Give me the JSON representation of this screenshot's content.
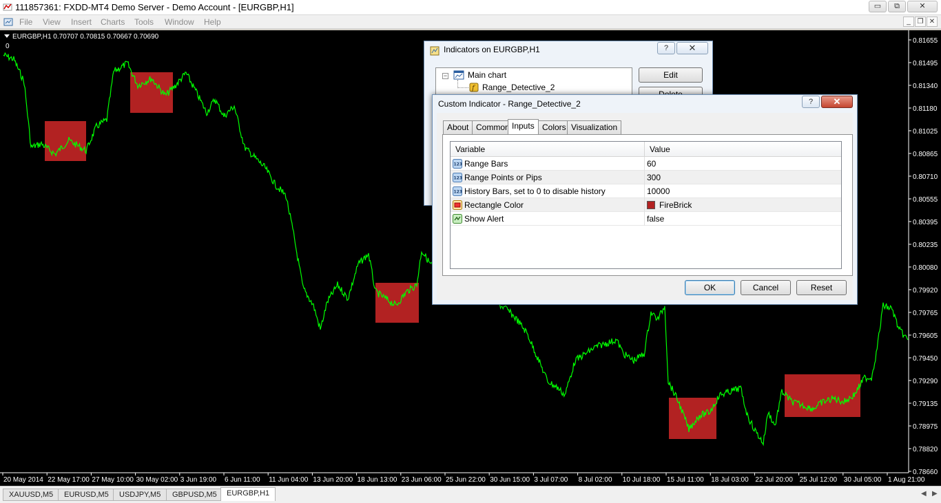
{
  "window": {
    "title": "111857361: FXDD-MT4 Demo Server - Demo Account - [EURGBP,H1]",
    "minimize_glyph": "▭",
    "restore_glyph": "⧉",
    "close_glyph": "✕",
    "mdi_minimize_glyph": "_",
    "mdi_restore_glyph": "❐",
    "mdi_close_glyph": "✕"
  },
  "menu": [
    "File",
    "View",
    "Insert",
    "Charts",
    "Tools",
    "Window",
    "Help"
  ],
  "chart": {
    "symbol_info": "EURGBP,H1  0.70707 0.70815 0.70667 0.70690",
    "zero_label": "0",
    "price_labels": [
      "0.81655",
      "0.81495",
      "0.81340",
      "0.81180",
      "0.81025",
      "0.80865",
      "0.80710",
      "0.80555",
      "0.80395",
      "0.80235",
      "0.80080",
      "0.79920",
      "0.79765",
      "0.79605",
      "0.79450",
      "0.79290",
      "0.79135",
      "0.78975",
      "0.78820",
      "0.78660"
    ],
    "time_labels": [
      "20 May 2014",
      "22 May 17:00",
      "27 May 10:00",
      "30 May 02:00",
      "3 Jun 19:00",
      "6 Jun 11:00",
      "11 Jun 04:00",
      "13 Jun 20:00",
      "18 Jun 13:00",
      "23 Jun 06:00",
      "25 Jun 22:00",
      "30 Jun 15:00",
      "3 Jul 07:00",
      "8 Jul 02:00",
      "10 Jul 18:00",
      "15 Jul 11:00",
      "18 Jul 03:00",
      "22 Jul 20:00",
      "25 Jul 12:00",
      "30 Jul 05:00",
      "1 Aug 21:00"
    ],
    "line_color": "#00ff00",
    "rect_color": "#b22222",
    "background": "#000000"
  },
  "symbol_tabs": [
    "XAUUSD,M5",
    "EURUSD,M5",
    "USDJPY,M5",
    "GBPUSD,M5",
    "EURGBP,H1"
  ],
  "active_tab": "EURGBP,H1",
  "tab_scroll": {
    "left": "◀",
    "right": "▶"
  },
  "indicators_dialog": {
    "title": "Indicators on EURGBP,H1",
    "help": "?",
    "close": "✕",
    "tree_root": "Main chart",
    "tree_child": "Range_Detective_2",
    "edit_button": "Edit",
    "delete_button": "Delete",
    "collapse_glyph": "−"
  },
  "custom_dialog": {
    "title": "Custom Indicator - Range_Detective_2",
    "help": "?",
    "close": "✕",
    "tabs": [
      "About",
      "Common",
      "Inputs",
      "Colors",
      "Visualization"
    ],
    "active_tab": "Inputs",
    "columns": {
      "variable": "Variable",
      "value": "Value"
    },
    "rows": [
      {
        "name": "Range Bars",
        "value": "60",
        "icon": "integer-icon"
      },
      {
        "name": "Range Points or Pips",
        "value": "300",
        "icon": "integer-icon"
      },
      {
        "name": "History Bars, set to 0 to disable history",
        "value": "10000",
        "icon": "integer-icon"
      },
      {
        "name": "Rectangle Color",
        "value": "FireBrick",
        "icon": "color-icon"
      },
      {
        "name": "Show Alert",
        "value": "false",
        "icon": "boolean-icon"
      }
    ],
    "int_icon_text": "123",
    "ok": "OK",
    "cancel": "Cancel",
    "reset": "Reset"
  }
}
